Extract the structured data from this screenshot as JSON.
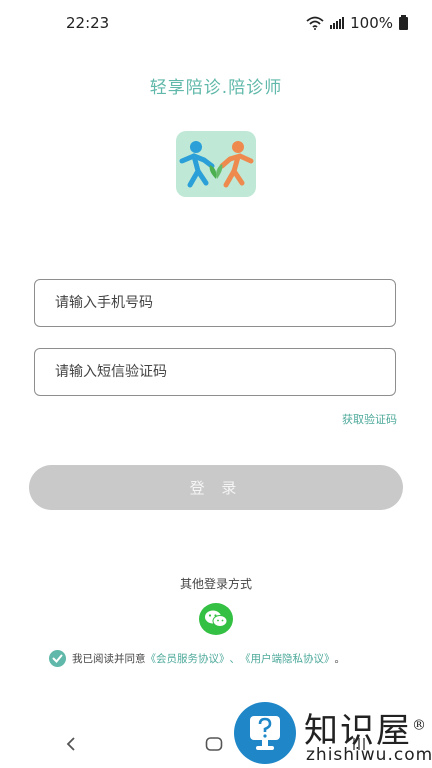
{
  "status_bar": {
    "time": "22:23",
    "battery": "100%"
  },
  "app_title": "轻享陪诊.陪诊师",
  "phone_input": {
    "placeholder": "请输入手机号码",
    "value": ""
  },
  "code_input": {
    "placeholder": "请输入短信验证码",
    "value": ""
  },
  "get_code_label": "获取验证码",
  "login_label": "登 录",
  "other_login_label": "其他登录方式",
  "agreement": {
    "prefix": "我已阅读并同意",
    "member_link": "《会员服务协议》",
    "separator": "、",
    "privacy_link": "《用户端隐私协议》",
    "suffix": "。",
    "checked": true
  },
  "watermark": {
    "title": "知识屋",
    "registered": "®",
    "url": "zhishiwu.com"
  },
  "colors": {
    "accent": "#5fb8a9",
    "button_disabled": "#c9c9c9",
    "wechat": "#34c043"
  }
}
